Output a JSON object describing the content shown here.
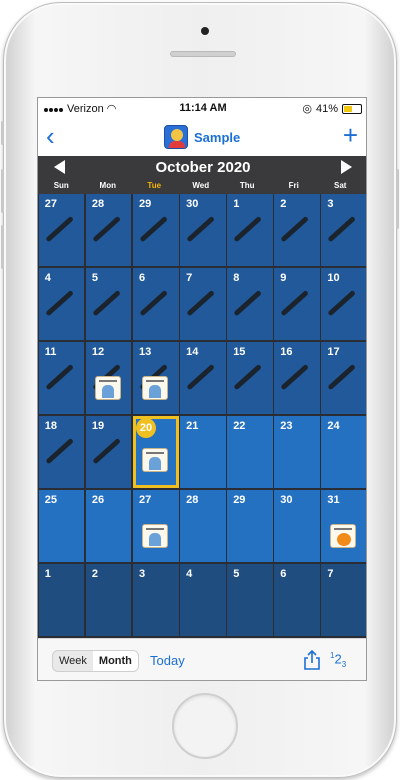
{
  "status_bar": {
    "carrier": "Verizon",
    "time": "11:14 AM",
    "battery": "41%"
  },
  "nav": {
    "title": "Sample",
    "back_icon": "chevron-left-icon",
    "add_icon": "plus-icon"
  },
  "calendar": {
    "month_title": "October 2020",
    "weekdays": [
      "Sun",
      "Mon",
      "Tue",
      "Wed",
      "Thu",
      "Fri",
      "Sat"
    ],
    "today_weekday_index": 2,
    "selected_date": "20",
    "weeks": [
      [
        "27",
        "28",
        "29",
        "30",
        "1",
        "2",
        "3"
      ],
      [
        "4",
        "5",
        "6",
        "7",
        "8",
        "9",
        "10"
      ],
      [
        "11",
        "12",
        "13",
        "14",
        "15",
        "16",
        "17"
      ],
      [
        "18",
        "19",
        "20",
        "21",
        "22",
        "23",
        "24"
      ],
      [
        "25",
        "26",
        "27",
        "28",
        "29",
        "30",
        "31"
      ],
      [
        "1",
        "2",
        "3",
        "4",
        "5",
        "6",
        "7"
      ]
    ],
    "events": [
      {
        "date": "12",
        "type": "picture"
      },
      {
        "date": "13",
        "type": "picture"
      },
      {
        "date": "20",
        "type": "picture"
      },
      {
        "date": "27",
        "type": "picture"
      },
      {
        "date": "31",
        "type": "pumpkin",
        "label": "Halloween"
      }
    ],
    "colors": {
      "current_month": "#2470c1",
      "past_day": "#21599a",
      "outside_month": "#1f4d80",
      "selected_outline": "#f0c020",
      "today_weekday": "#f5b400"
    }
  },
  "toolbar": {
    "week_label": "Week",
    "month_label": "Month",
    "active_view": "Month",
    "today_label": "Today",
    "share_icon": "share-icon",
    "numbers_label": "1 2 3"
  }
}
